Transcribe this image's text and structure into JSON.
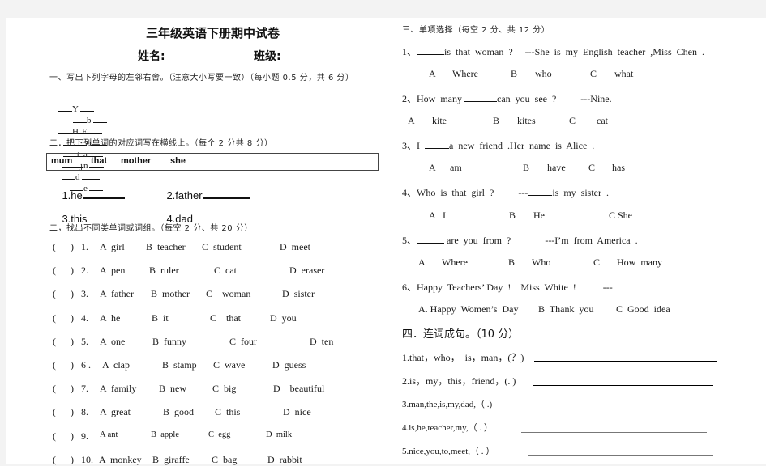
{
  "header": {
    "title": "三年级英语下册期中试卷",
    "name_label": "姓名:",
    "class_label": "班级:"
  },
  "section1": {
    "heading": "一、写出下列字母的左邻右舍。（注意大小写要一致）（每小题 0.5 分，共 6 分）",
    "row1": [
      "Y",
      "b",
      "F",
      "i",
      "t",
      "n"
    ],
    "row2": [
      "H",
      "o",
      "a",
      "j",
      "d",
      "e"
    ]
  },
  "section2": {
    "heading": "二．把下列单词的对应词写在横线上。（每个 2 分共 8 分）",
    "word_box": [
      "mum",
      "that",
      "mother",
      "she"
    ],
    "items": [
      "1.he",
      "2.father",
      "3.this",
      "4.dad"
    ]
  },
  "section3": {
    "heading": "二，找出不同类单词或词组。（每空 2 分、共 20 分）",
    "questions": [
      {
        "num": "1.",
        "A": "A  girl",
        "B": "B  teacher",
        "C": "C  student",
        "D": "D  meet"
      },
      {
        "num": "2.",
        "A": "A  pen",
        "B": "B  ruler",
        "C": "C  cat",
        "D": "D  eraser"
      },
      {
        "num": "3.",
        "A": "A  father",
        "B": "B  mother",
        "C": "C    woman",
        "D": "D  sister"
      },
      {
        "num": "4.",
        "A": "A  he",
        "B": "B  it",
        "C": "C    that",
        "D": "D  you"
      },
      {
        "num": "5.",
        "A": "A  one",
        "B": "B  funny",
        "C": "C  four",
        "D": "D  ten"
      },
      {
        "num": "6 .",
        "A": "A  clap",
        "B": "B  stamp",
        "C": "C  wave",
        "D": "D  guess"
      },
      {
        "num": "7.",
        "A": "A  family",
        "B": "B  new",
        "C": "C  big",
        "D": "D    beautiful"
      },
      {
        "num": "8.",
        "A": "A  great",
        "B": "B  good",
        "C": "C  this",
        "D": "D  nice"
      },
      {
        "num": "9.",
        "A": "A ant",
        "B": "B  apple",
        "C": "C  egg",
        "D": "D  milk"
      },
      {
        "num": "10.",
        "A": "A  monkey",
        "B": "B  giraffe",
        "C": "C  bag",
        "D": "D  rabbit"
      }
    ],
    "bracket": "(      )"
  },
  "section4": {
    "heading": "三、单项选择（每空 2 分、共 12 分）",
    "questions": [
      {
        "stem_pre": "1、",
        "stem_post": "is  that  woman  ?     ---She  is  my  English  teacher  ,Miss  Chen  .",
        "options": [
          "A",
          "Where",
          "B",
          "who",
          "C",
          "what"
        ]
      },
      {
        "stem_pre": "2、How  many ",
        "stem_post": "can  you  see  ?          ---Nine.",
        "options": [
          "A",
          "kite",
          "B",
          "kites",
          "C",
          "cat"
        ]
      },
      {
        "stem_pre": "3、I  ",
        "stem_post": "a  new  friend  .Her  name  is  Alice  .",
        "options": [
          "A",
          "am",
          "B",
          "have",
          "C",
          "has"
        ]
      },
      {
        "stem_pre": "4、Who  is  that  girl  ?          ---",
        "stem_post": "is  my  sister  .",
        "options": [
          "A",
          "I",
          "B",
          "He",
          "C She",
          ""
        ]
      },
      {
        "stem_pre": "5、",
        "stem_post": " are  you  from  ?              ---I’m  from  America  .",
        "options": [
          "A",
          "Where",
          "B",
          "Who",
          "C",
          "How  many"
        ]
      },
      {
        "stem_pre": "6、Happy  Teachers’ Day  !    Miss  White  !           ---",
        "stem_post": "",
        "options": [
          "A. Happy  Women’s  Day",
          "B  Thank  you",
          "C  Good  idea"
        ]
      }
    ]
  },
  "section5": {
    "heading": "四．连词成句。（10 分）",
    "items": [
      "1.that，who，  is，man，(？)",
      "2.is，my，this，friend，(. )",
      "3.man,the,is,my,dad,（ .)",
      "4.is,he,teacher,my,（ . ）",
      "5.nice,you,to,meet,（ . ）"
    ]
  }
}
